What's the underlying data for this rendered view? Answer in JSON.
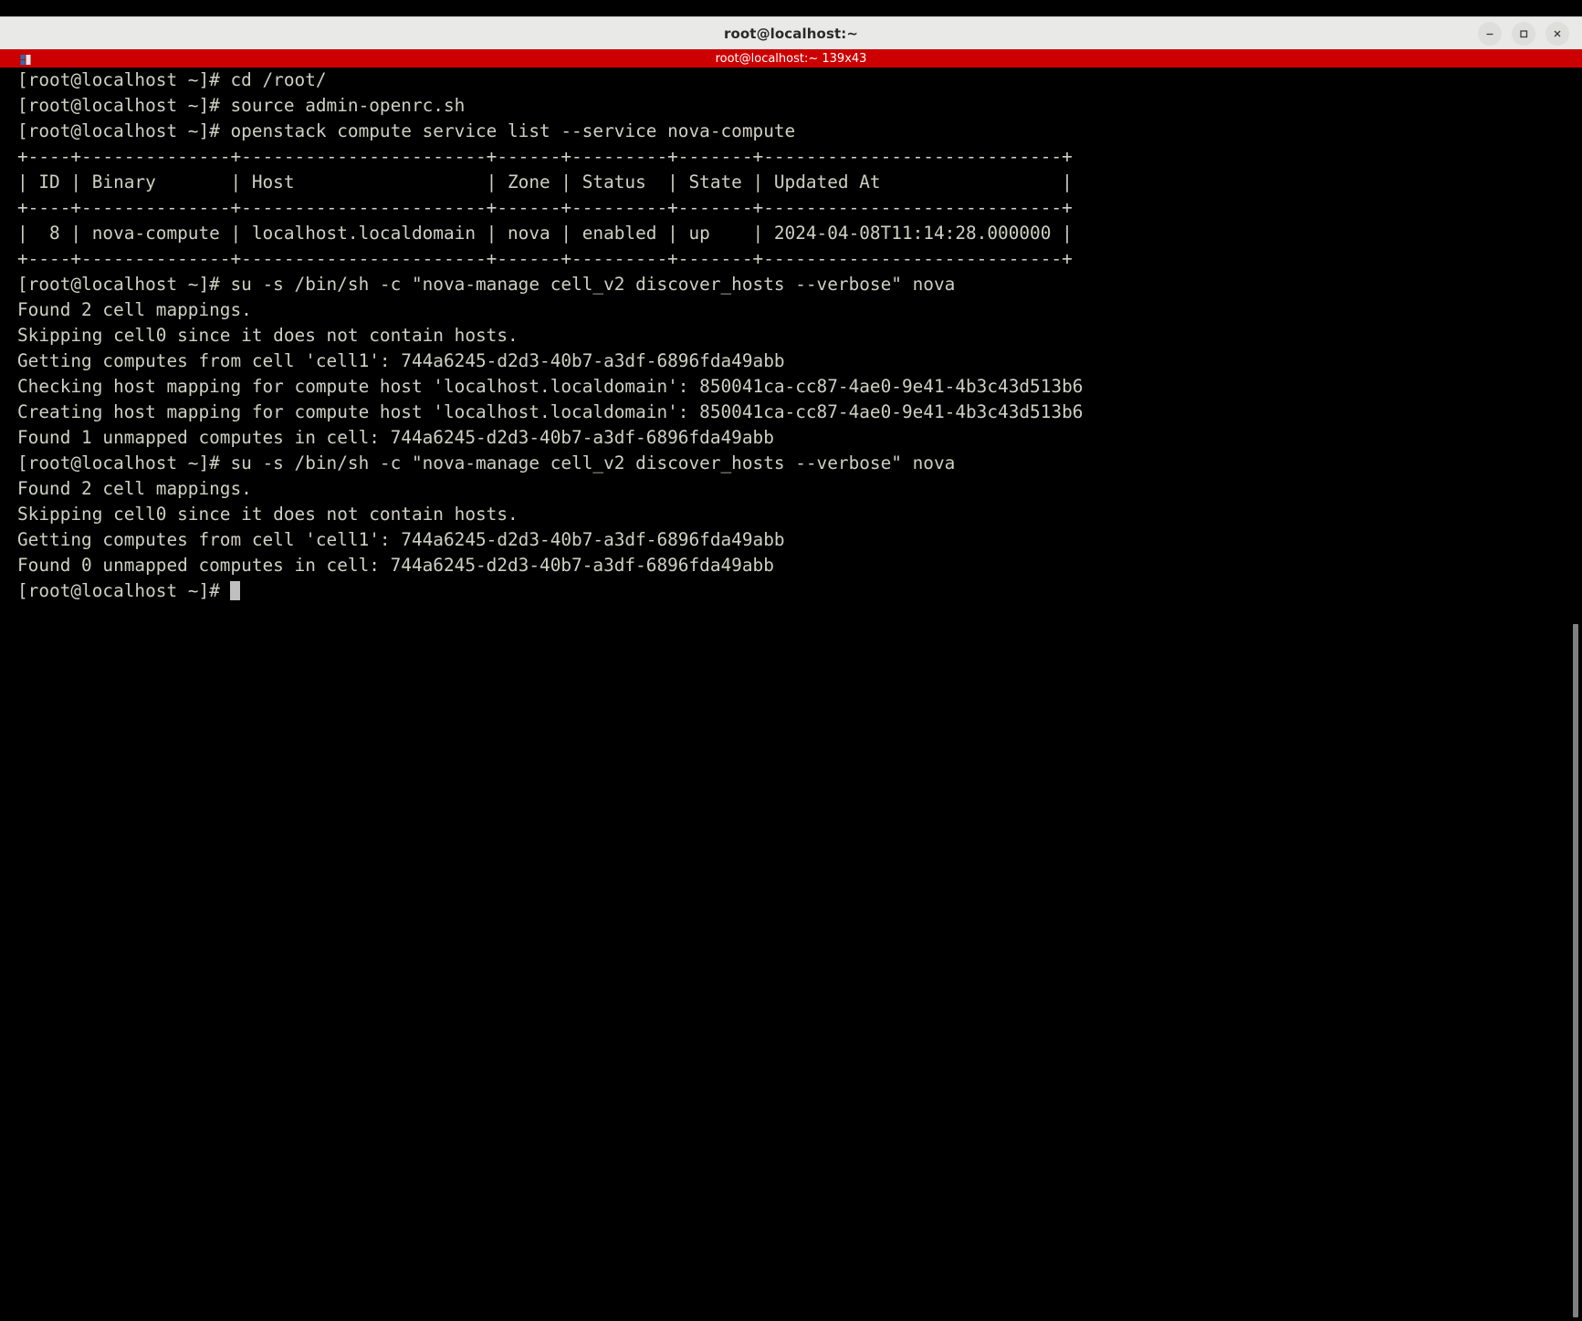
{
  "window": {
    "title": "root@localhost:~",
    "controls": [
      {
        "name": "minimize-button",
        "glyph": "–"
      },
      {
        "name": "maximize-button",
        "glyph": "□"
      },
      {
        "name": "close-button",
        "glyph": "×"
      }
    ]
  },
  "tab": {
    "label": "root@localhost:~ 139x43",
    "icon": "terminal-tab-icon",
    "background": "#cc0000"
  },
  "colors": {
    "terminal_background": "#000000",
    "terminal_foreground": "#cfd0c2",
    "titlebar_background": "#e9e9e7",
    "tabbar_background": "#cc0000",
    "cursor": "#bfbfbf",
    "scrollbar_thumb": "#808080"
  },
  "terminal": {
    "prompt": "[root@localhost ~]#",
    "cursor_visible": true,
    "lines": [
      "[root@localhost ~]# cd /root/",
      "[root@localhost ~]# source admin-openrc.sh",
      "[root@localhost ~]# openstack compute service list --service nova-compute",
      "+----+--------------+-----------------------+------+---------+-------+----------------------------+",
      "| ID | Binary       | Host                  | Zone | Status  | State | Updated At                 |",
      "+----+--------------+-----------------------+------+---------+-------+----------------------------+",
      "|  8 | nova-compute | localhost.localdomain | nova | enabled | up    | 2024-04-08T11:14:28.000000 |",
      "+----+--------------+-----------------------+------+---------+-------+----------------------------+",
      "[root@localhost ~]# su -s /bin/sh -c \"nova-manage cell_v2 discover_hosts --verbose\" nova",
      "Found 2 cell mappings.",
      "Skipping cell0 since it does not contain hosts.",
      "Getting computes from cell 'cell1': 744a6245-d2d3-40b7-a3df-6896fda49abb",
      "Checking host mapping for compute host 'localhost.localdomain': 850041ca-cc87-4ae0-9e41-4b3c43d513b6",
      "Creating host mapping for compute host 'localhost.localdomain': 850041ca-cc87-4ae0-9e41-4b3c43d513b6",
      "Found 1 unmapped computes in cell: 744a6245-d2d3-40b7-a3df-6896fda49abb",
      "[root@localhost ~]# su -s /bin/sh -c \"nova-manage cell_v2 discover_hosts --verbose\" nova",
      "Found 2 cell mappings.",
      "Skipping cell0 since it does not contain hosts.",
      "Getting computes from cell 'cell1': 744a6245-d2d3-40b7-a3df-6896fda49abb",
      "Found 0 unmapped computes in cell: 744a6245-d2d3-40b7-a3df-6896fda49abb"
    ],
    "last_line": "[root@localhost ~]# ",
    "service_table": {
      "columns": [
        "ID",
        "Binary",
        "Host",
        "Zone",
        "Status",
        "State",
        "Updated At"
      ],
      "rows": [
        [
          "8",
          "nova-compute",
          "localhost.localdomain",
          "nova",
          "enabled",
          "up",
          "2024-04-08T11:14:28.000000"
        ]
      ]
    },
    "cell_uuid": "744a6245-d2d3-40b7-a3df-6896fda49abb",
    "host_mapping_uuid": "850041ca-cc87-4ae0-9e41-4b3c43d513b6"
  }
}
